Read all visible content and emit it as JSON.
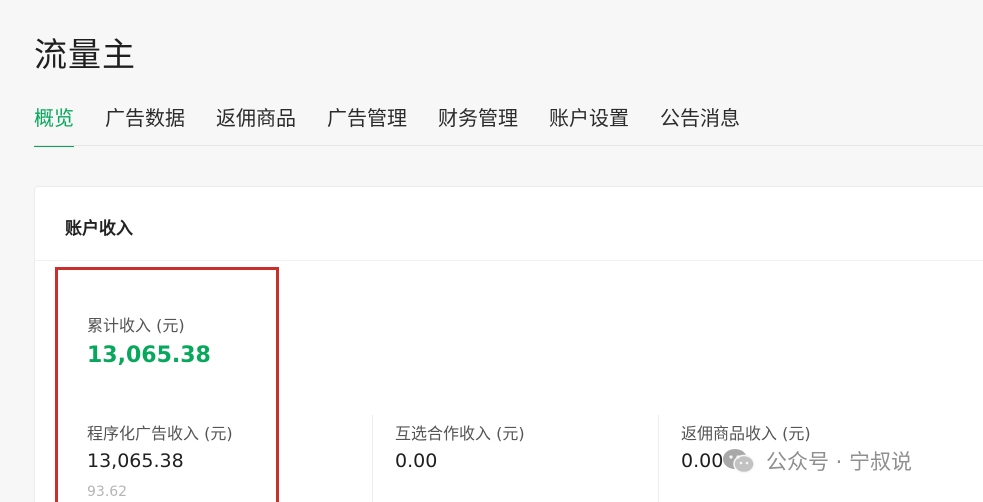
{
  "app": {
    "title": "流量主"
  },
  "tabs": [
    {
      "label": "概览",
      "active": true
    },
    {
      "label": "广告数据"
    },
    {
      "label": "返佣商品"
    },
    {
      "label": "广告管理"
    },
    {
      "label": "财务管理"
    },
    {
      "label": "账户设置"
    },
    {
      "label": "公告消息"
    }
  ],
  "account_income": {
    "title": "账户收入",
    "total": {
      "label": "累计收入 (元)",
      "value": "13,065.38"
    },
    "programmatic_ads": {
      "label": "程序化广告收入 (元)",
      "value": "13,065.38",
      "sub_value": "93.62"
    },
    "mutual_selection": {
      "label": "互选合作收入 (元)",
      "value": "0.00"
    },
    "commission_goods": {
      "label": "返佣商品收入 (元)",
      "value": "0.00"
    }
  },
  "watermark": {
    "text": "公众号 · 宁叔说",
    "icon": "wechat-icon"
  },
  "colors": {
    "accent": "#07a85c",
    "highlight_border": "#c9302c"
  }
}
